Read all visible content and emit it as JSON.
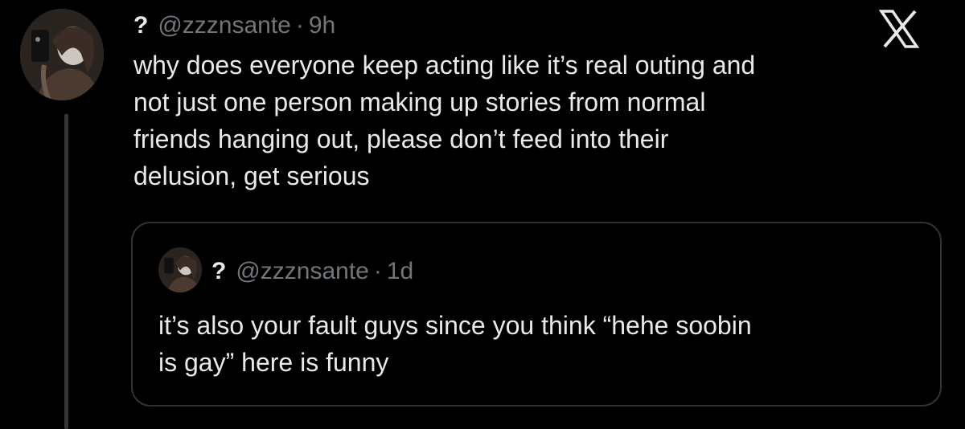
{
  "tweet": {
    "name": "?",
    "handle": "@zzznsante",
    "separator": "·",
    "time": "9h",
    "text": "why does everyone keep acting like it’s real outing and\nnot just one person making up stories from normal\nfriends hanging out, please don’t feed into their\ndelusion, get serious",
    "logo_icon": "x-logo-icon"
  },
  "quote": {
    "name": "?",
    "handle": "@zzznsante",
    "separator": "·",
    "time": "1d",
    "text": "it’s also your fault guys since you think “hehe soobin\nis gay” here is funny"
  }
}
